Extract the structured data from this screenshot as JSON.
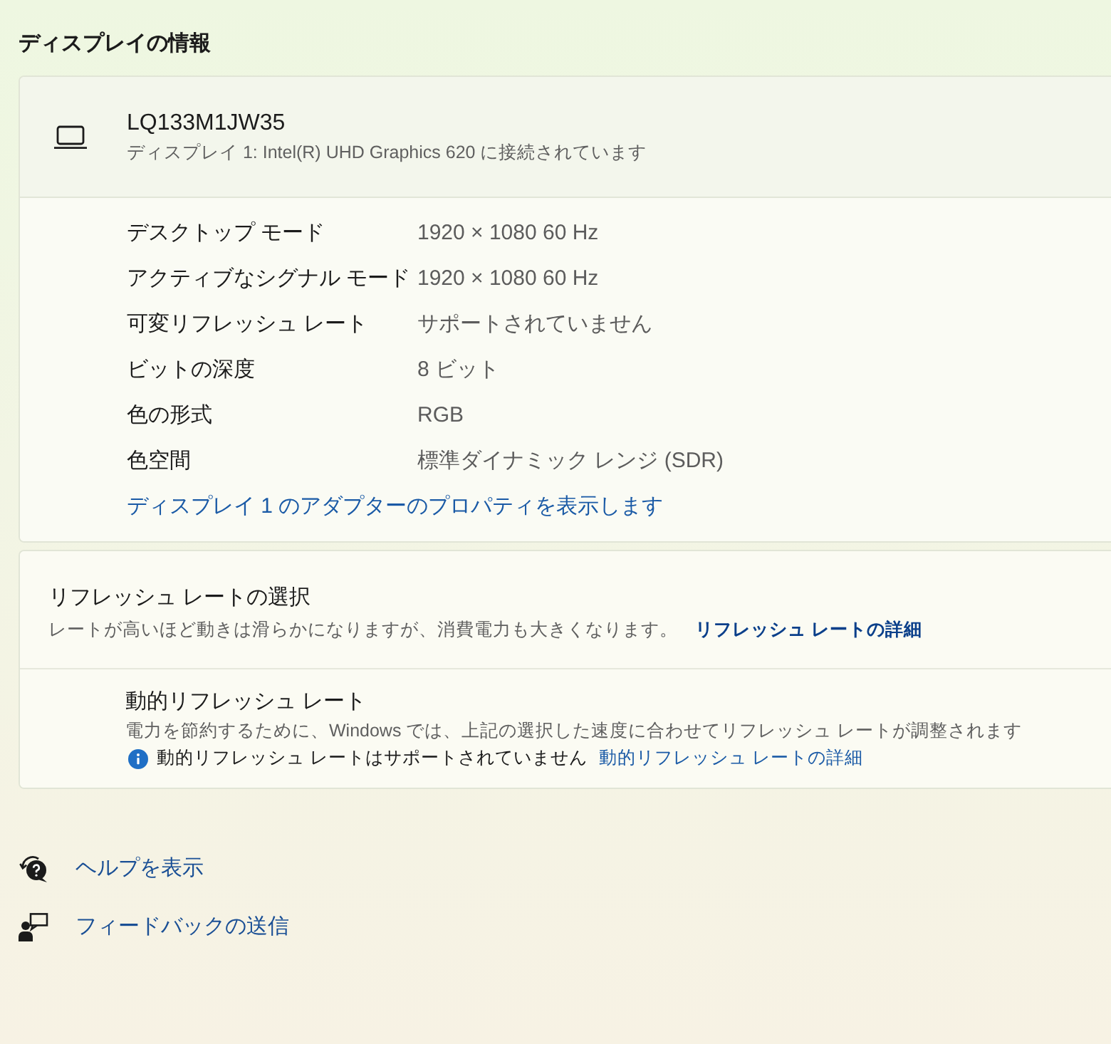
{
  "section_title": "ディスプレイの情報",
  "display_card": {
    "name": "LQ133M1JW35",
    "connection": "ディスプレイ 1: Intel(R) UHD Graphics 620 に接続されています",
    "properties": [
      {
        "label": "デスクトップ モード",
        "value": "1920 × 1080 60 Hz"
      },
      {
        "label": "アクティブなシグナル モード",
        "value": "1920 × 1080 60 Hz"
      },
      {
        "label": "可変リフレッシュ レート",
        "value": "サポートされていません"
      },
      {
        "label": "ビットの深度",
        "value": "8 ビット"
      },
      {
        "label": "色の形式",
        "value": "RGB"
      },
      {
        "label": "色空間",
        "value": "標準ダイナミック レンジ (SDR)"
      }
    ],
    "adapter_link": "ディスプレイ 1 のアダプターのプロパティを表示します"
  },
  "refresh_card": {
    "title": "リフレッシュ レートの選択",
    "description": "レートが高いほど動きは滑らかになりますが、消費電力も大きくなります。",
    "link": "リフレッシュ レートの詳細",
    "dynamic": {
      "title": "動的リフレッシュ レート",
      "description": "電力を節約するために、Windows では、上記の選択した速度に合わせてリフレッシュ レートが調整されます",
      "notice": "動的リフレッシュ レートはサポートされていません",
      "link": "動的リフレッシュ レートの詳細"
    }
  },
  "footer_links": [
    {
      "kind": "help",
      "label": "ヘルプを表示"
    },
    {
      "kind": "feedback",
      "label": "フィードバックの送信"
    }
  ]
}
